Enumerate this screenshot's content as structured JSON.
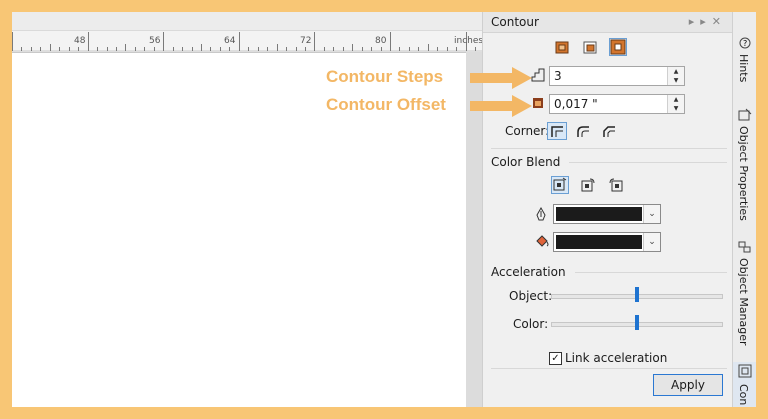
{
  "ruler": {
    "marks": [
      "48",
      "56",
      "64",
      "72",
      "80"
    ],
    "unit": "inches"
  },
  "docker": {
    "title": "Contour",
    "steps_value": "3",
    "offset_value": "0,017 \"",
    "corner_label": "Corner:",
    "color_blend_title": "Color Blend",
    "acceleration_title": "Acceleration",
    "object_label": "Object:",
    "object_accel": 0.5,
    "color_label": "Color:",
    "color_accel": 0.5,
    "link_label": "Link acceleration",
    "link_checked": true,
    "apply_label": "Apply",
    "outline_color": "#1b1b1b",
    "fill_color": "#1b1b1b"
  },
  "tabs": {
    "hints": "Hints",
    "object_properties": "Object Properties",
    "object_manager": "Object Manager",
    "contour": "Con"
  },
  "annotations": {
    "steps": "Contour Steps",
    "offset": "Contour Offset",
    "color": "#f3b765"
  },
  "icons": {
    "to_center": "contour-to-center-icon",
    "inside": "contour-inside-icon",
    "outside": "contour-outside-icon",
    "steps": "contour-steps-icon",
    "offset": "contour-offset-icon",
    "outline_pen": "outline-pen-icon",
    "fill_bucket": "fill-bucket-icon"
  }
}
